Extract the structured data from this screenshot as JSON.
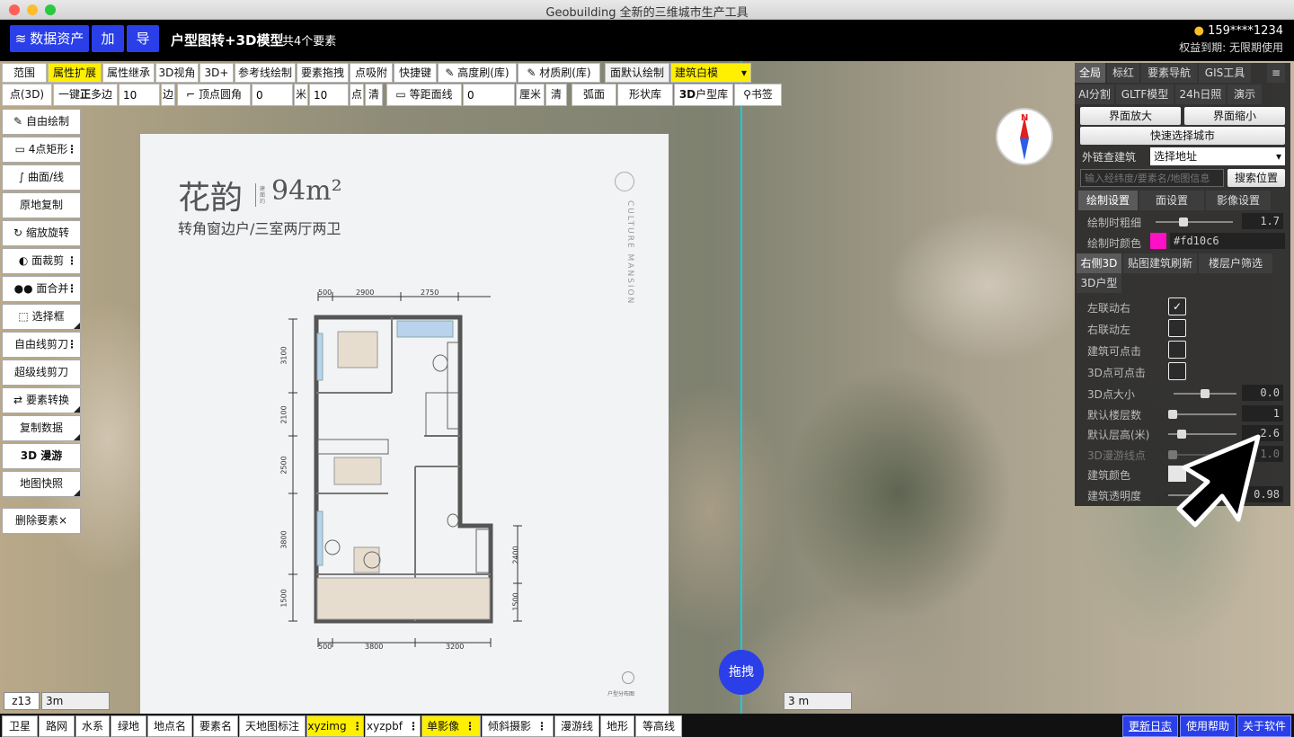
{
  "window": {
    "title": "Geobuilding 全新的三维城市生产工具"
  },
  "appbar": {
    "assets": "数据资产",
    "add": "加",
    "export": "导",
    "doc_title": "户型图转+3D模型",
    "doc_count": "共4个要素",
    "user": "159****1234",
    "rights": "权益到期: 无限期使用"
  },
  "toolbar1": [
    "范围",
    "属性扩展",
    "属性继承",
    "3D视角",
    "3D+",
    "参考线绘制",
    "要素拖拽",
    "点吸附",
    "快捷键",
    "高度刷(库)",
    "材质刷(库)",
    "面默认绘制",
    "建筑白模"
  ],
  "toolbar2": {
    "point3d": "点(3D)",
    "polygon_prefix": "一键",
    "polygon_bold": "正",
    "polygon_suffix": "多边",
    "sides_value": "10",
    "sides_unit": "边",
    "corner_label": "顶点圆角",
    "corner_value": "0",
    "corner_unit": "米",
    "points_value": "10",
    "points_unit": "点",
    "clear1": "清",
    "equidist": "等距面线",
    "equidist_value": "0",
    "equidist_unit": "厘米",
    "clear2": "清",
    "arc": "弧面",
    "shape_lib": "形状库",
    "lib3d_bold": "3D",
    "lib3d": "户型库",
    "bookmark": "书签"
  },
  "left_tools": [
    "自由绘制",
    "4点矩形",
    "曲面/线",
    "原地复制",
    "缩放旋转",
    "面裁剪",
    "面合并",
    "选择框",
    "自由线剪刀",
    "超级线剪刀",
    "要素转换",
    "复制数据",
    "3D 漫游",
    "地图快照",
    "删除要素×"
  ],
  "floorplan": {
    "name": "花韵",
    "area": "94m²",
    "area_tag": "建面约",
    "subtitle": "转角窗边户/三室两厅两卫",
    "brand": "CULTURE MANSION",
    "dims_top": [
      "500",
      "2900",
      "2750"
    ],
    "dims_bottom": [
      "500",
      "3800",
      "3200"
    ],
    "dims_left": [
      "3100",
      "2100",
      "2500",
      "3800",
      "1500"
    ],
    "dims_right": [
      "2400",
      "1500"
    ],
    "locator": "户型分布图"
  },
  "right_panel": {
    "tabs_row1": [
      "全局",
      "标红",
      "要素导航",
      "GIS工具",
      "≡"
    ],
    "tabs_row2": [
      "AI分割",
      "GLTF模型",
      "24h日照",
      "演示"
    ],
    "zoom_in": "界面放大",
    "zoom_out": "界面缩小",
    "quick_city": "快速选择城市",
    "ext_label": "外链查建筑",
    "address_select": "选择地址",
    "search_placeholder": "输入经纬度/要素名/地图信息",
    "search_btn": "搜索位置",
    "settings_tabs": [
      "绘制设置",
      "面设置",
      "影像设置"
    ],
    "draw_width_label": "绘制时粗细",
    "draw_width": "1.7",
    "draw_color_label": "绘制时颜色",
    "draw_color": "#fd10c6",
    "sub_tabs": [
      "右侧3D",
      "贴图建筑刷新",
      "楼层户筛选"
    ],
    "sub_tab2": "3D户型",
    "rows": [
      {
        "label": "左联动右",
        "checked": true
      },
      {
        "label": "右联动左",
        "checked": false
      },
      {
        "label": "建筑可点击",
        "checked": false
      },
      {
        "label": "3D点可点击",
        "checked": false
      }
    ],
    "point_size_label": "3D点大小",
    "point_size": "0.0",
    "floors_label": "默认楼层数",
    "floors": "1",
    "floor_height_label": "默认层高(米)",
    "floor_height": "2.6",
    "roam_label": "3D漫游线点",
    "roam": "1.0",
    "building_color_label": "建筑颜色",
    "opacity_label": "建筑透明度",
    "opacity": "0.98"
  },
  "map": {
    "zoom": "z13",
    "scale_left": "3m",
    "scale_right": "3 m",
    "drag": "拖拽",
    "compass": "N"
  },
  "bottombar": [
    "卫星",
    "路网",
    "水系",
    "绿地",
    "地点名",
    "要素名",
    "天地图标注",
    "xyzimg",
    "xyzpbf",
    "单影像",
    "倾斜摄影",
    "漫游线",
    "地形",
    "等高线"
  ],
  "links": [
    "更新日志",
    "使用帮助",
    "关于软件"
  ],
  "colors": {
    "accent": "#2a3fe8",
    "highlight": "#ffef00",
    "draw": "#fd10c6"
  }
}
